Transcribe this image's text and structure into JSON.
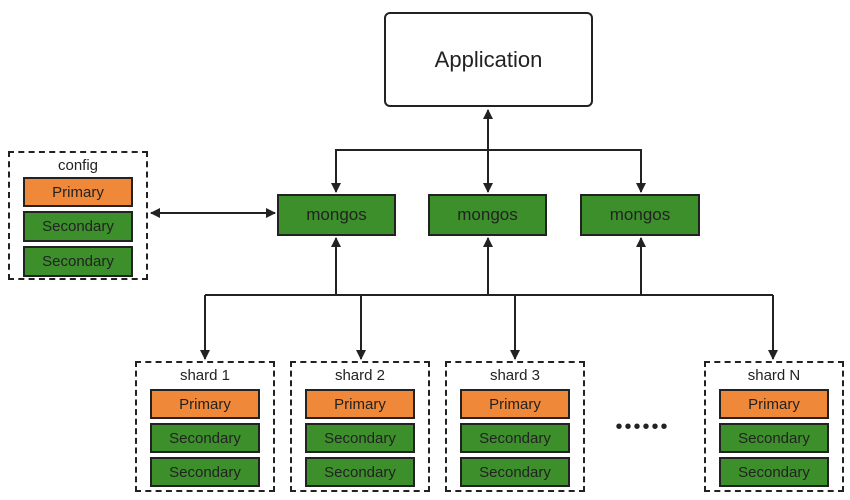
{
  "colors": {
    "primary": "#f0883a",
    "secondary": "#3d8f2c",
    "mongos": "#3d8f2c",
    "line": "#222222"
  },
  "application": {
    "label": "Application"
  },
  "mongos": [
    {
      "label": "mongos"
    },
    {
      "label": "mongos"
    },
    {
      "label": "mongos"
    }
  ],
  "config": {
    "title": "config",
    "members": [
      "Primary",
      "Secondary",
      "Secondary"
    ]
  },
  "shards": [
    {
      "title": "shard 1",
      "members": [
        "Primary",
        "Secondary",
        "Secondary"
      ]
    },
    {
      "title": "shard 2",
      "members": [
        "Primary",
        "Secondary",
        "Secondary"
      ]
    },
    {
      "title": "shard 3",
      "members": [
        "Primary",
        "Secondary",
        "Secondary"
      ]
    },
    {
      "title": "shard N",
      "members": [
        "Primary",
        "Secondary",
        "Secondary"
      ]
    }
  ],
  "ellipsis": "••••••"
}
